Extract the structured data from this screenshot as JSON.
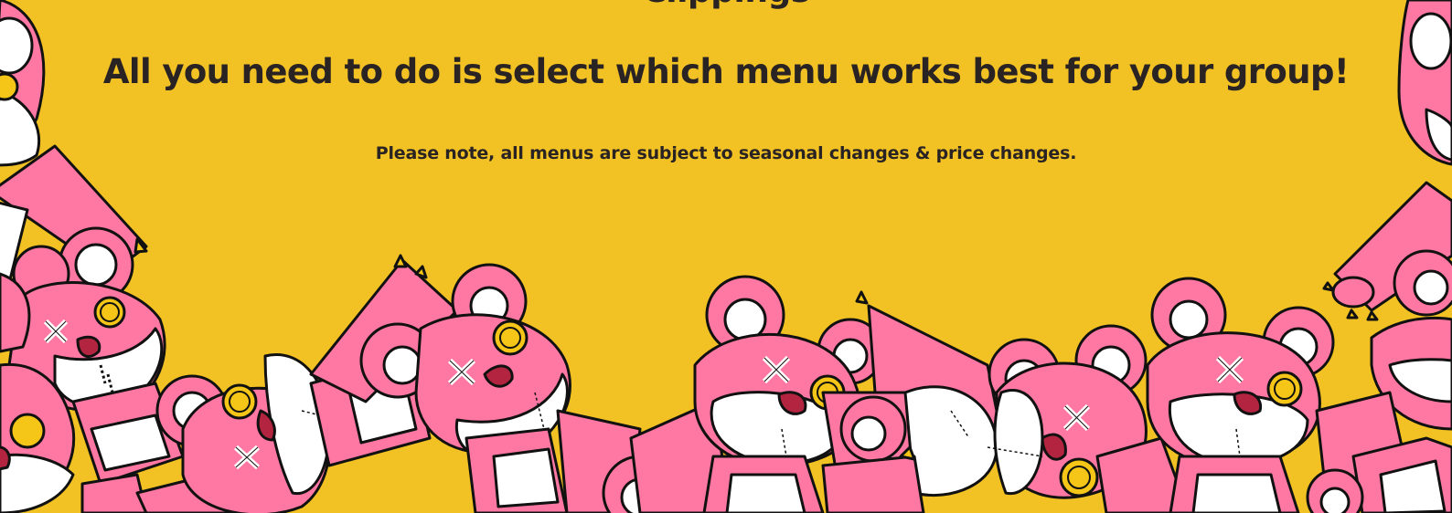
{
  "colors": {
    "background": "#f2c224",
    "text": "#2a2323",
    "bear_pink": "#ff78a4",
    "bear_white": "#ffffff",
    "outline": "#111111",
    "button_eye": "#f5c617",
    "mouth": "#b2243f"
  },
  "header": {
    "clipped_title": "Clippings",
    "headline": "All you need to do is select which menu works best for your group!",
    "note": "Please note, all menus are subject to seasonal changes & price changes."
  },
  "decoration": {
    "description_icon": "pink-teddy-bear-pile",
    "bear_count": 8
  }
}
